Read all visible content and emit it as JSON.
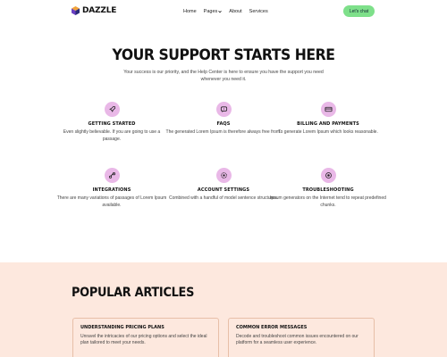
{
  "brand": {
    "name": "DAZZLE"
  },
  "nav": {
    "items": [
      {
        "label": "Home"
      },
      {
        "label": "Pages"
      },
      {
        "label": "About"
      },
      {
        "label": "Services"
      }
    ],
    "cta_label": "Let's chat"
  },
  "hero": {
    "title": "YOUR SUPPORT STARTS HERE",
    "subtitle": "Your success is our priority, and the Help Center is here to ensure you have the support you need whenever you need it."
  },
  "features": [
    {
      "title": "GETTING STARTED",
      "desc": "Even slightly believable. If you are going to use a passage.",
      "icon": "rocket-icon"
    },
    {
      "title": "FAQS",
      "desc": "The generated Lorem Ipsum is therefore always free from.",
      "icon": "chat-icon"
    },
    {
      "title": "BILLING AND PAYMENTS",
      "desc": "To generate Lorem Ipsum which looks reasonable.",
      "icon": "card-icon"
    },
    {
      "title": "INTEGRATIONS",
      "desc": "There are many variations of passages of Lorem Ipsum available.",
      "icon": "link-icon"
    },
    {
      "title": "ACCOUNT SETTINGS",
      "desc": "Combined with a handful of model sentence structures.",
      "icon": "gear-icon"
    },
    {
      "title": "TROUBLESHOOTING",
      "desc": "Ipsum generators on the Internet tend to repeat predefined chunks.",
      "icon": "target-icon"
    }
  ],
  "articles": {
    "title": "POPULAR ARTICLES",
    "items": [
      {
        "title": "UNDERSTANDING PRICING PLANS",
        "desc": "Unravel the intricacies of our pricing options and select the ideal plan tailored to meet your needs."
      },
      {
        "title": "COMMON ERROR MESSAGES",
        "desc": "Decode and troubleshoot common issues encountered on our platform for a seamless user experience."
      }
    ]
  },
  "colors": {
    "accent_green": "#7ee08a",
    "icon_pink": "#e9b8e7",
    "section_peach": "#fde8de"
  }
}
